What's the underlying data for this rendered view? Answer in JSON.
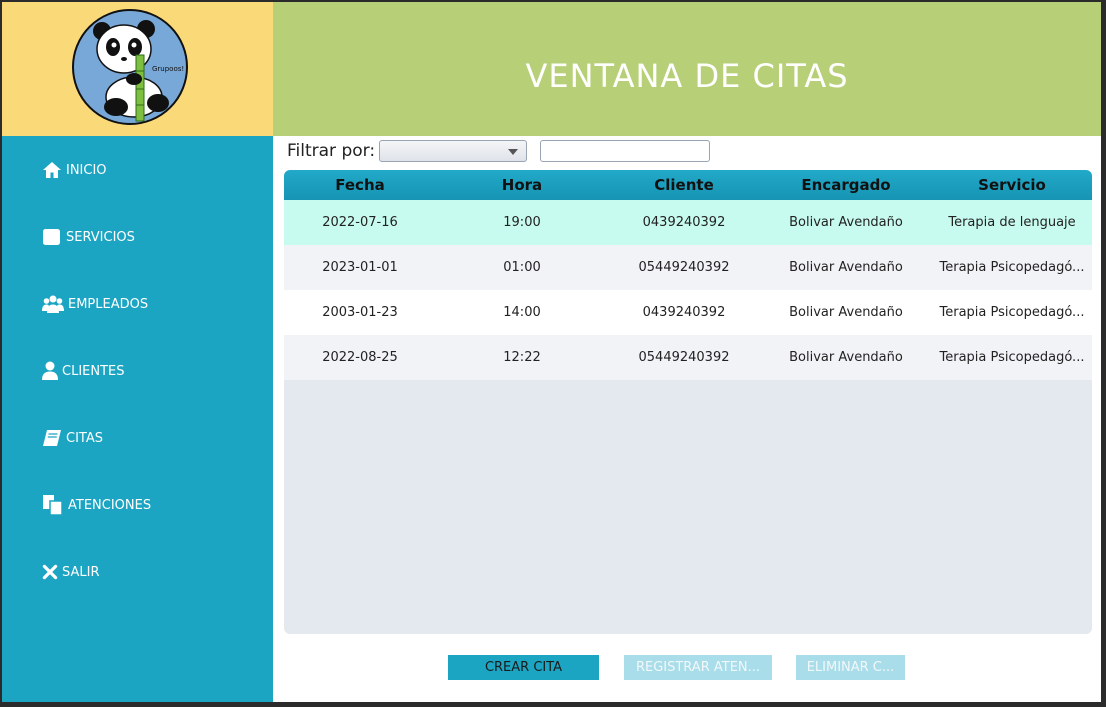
{
  "header": {
    "title": "VENTANA DE CITAS"
  },
  "logo": {
    "text": "Grupoos!",
    "bg_color": "#fad978"
  },
  "sidebar": {
    "items": [
      {
        "label": "INICIO",
        "icon": "home-icon"
      },
      {
        "label": "SERVICIOS",
        "icon": "square-icon"
      },
      {
        "label": "EMPLEADOS",
        "icon": "users-icon"
      },
      {
        "label": "CLIENTES",
        "icon": "user-icon"
      },
      {
        "label": "CITAS",
        "icon": "book-icon"
      },
      {
        "label": "ATENCIONES",
        "icon": "copy-icon"
      },
      {
        "label": "SALIR",
        "icon": "close-icon"
      }
    ]
  },
  "filter": {
    "label": "Filtrar por:",
    "selected": "",
    "search_value": ""
  },
  "table": {
    "columns": [
      "Fecha",
      "Hora",
      "Cliente",
      "Encargado",
      "Servicio"
    ],
    "rows": [
      [
        "2022-07-16",
        "19:00",
        "0439240392",
        "Bolivar Avendaño",
        "Terapia de lenguaje"
      ],
      [
        "2023-01-01",
        "01:00",
        "05449240392",
        "Bolivar Avendaño",
        "Terapia Psicopedagó..."
      ],
      [
        "2003-01-23",
        "14:00",
        "0439240392",
        "Bolivar Avendaño",
        "Terapia Psicopedagó..."
      ],
      [
        "2022-08-25",
        "12:22",
        "05449240392",
        "Bolivar Avendaño",
        "Terapia Psicopedagó..."
      ]
    ]
  },
  "buttons": {
    "crear": "CREAR CITA",
    "registrar": "REGISTRAR ATEN...",
    "eliminar": "ELIMINAR C..."
  },
  "colors": {
    "sidebar": "#1ca5c3",
    "header": "#b7d078",
    "selected_row": "#c8fbef",
    "accent": "#1ca5c3"
  }
}
